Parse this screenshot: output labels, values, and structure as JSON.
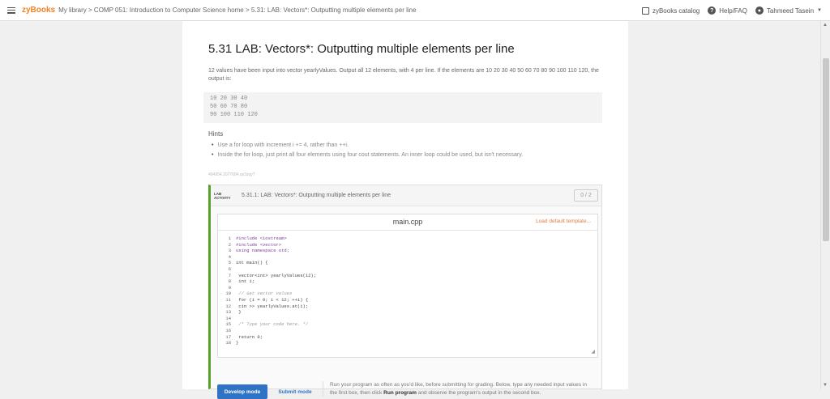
{
  "topbar": {
    "logo": "zyBooks",
    "breadcrumb": "My library > COMP 051: Introduction to Computer Science home > 5.31: LAB: Vectors*: Outputting multiple elements per line",
    "catalog": "zyBooks catalog",
    "help": "Help/FAQ",
    "user": "Tahmeed Tasein"
  },
  "content": {
    "title": "5.31 LAB: Vectors*: Outputting multiple elements per line",
    "description": "12 values have been input into vector yearlyValues. Output all 12 elements, with 4 per line. If the elements are 10 20 30 40 50 60 70 80 90 100 110 120, the output is:",
    "output_lines": [
      "10 20 30 40",
      "50 60 70 80",
      "90 100 110 120"
    ],
    "hints_label": "Hints",
    "hints": [
      "Use a for loop with increment i += 4, rather than ++i.",
      "Inside the for loop, just print all four elements using four cout statements. An inner loop could be used, but isn't necessary."
    ],
    "small_note": "494954.2077684.qx3zqy7"
  },
  "lab": {
    "tag_line1": "LAB",
    "tag_line2": "ACTIVITY",
    "title": "5.31.1: LAB: Vectors*: Outputting multiple elements per line",
    "score": "0 / 2",
    "filename": "main.cpp",
    "load_template": "Load default template...",
    "develop_mode": "Develop mode",
    "submit_mode": "Submit mode",
    "mode_text_1": "Run your program as often as you'd like, before submitting for grading. Below, type any needed input values in the first box, then click ",
    "mode_text_bold": "Run program",
    "mode_text_2": " and observe the program's output in the second box."
  },
  "code_lines": [
    "#include <iostream>",
    "#include <vector>",
    "using namespace std;",
    "",
    "int main() {",
    "",
    "   vector<int> yearlyValues(12);",
    "   int i;",
    "",
    "   // Get vector values",
    "   for (i = 0; i < 12; ++i) {",
    "      cin >> yearlyValues.at(i);",
    "   }",
    "",
    "   /* Type your code here. */",
    "",
    "   return 0;",
    "}"
  ]
}
